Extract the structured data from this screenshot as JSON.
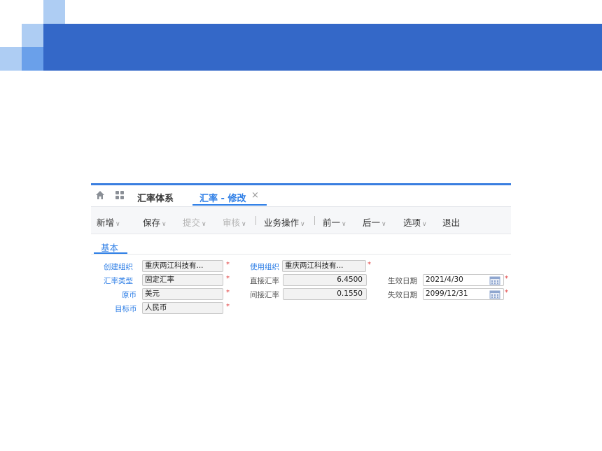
{
  "tabs": {
    "tab1": "汇率体系",
    "tab2": "汇率 - 修改",
    "close": "×"
  },
  "toolbar": {
    "new": "新增",
    "save": "保存",
    "submit": "提交",
    "audit": "审核",
    "business": "业务操作",
    "prev": "前一",
    "next": "后一",
    "options": "选项",
    "exit": "退出",
    "caret": "∨"
  },
  "subtab": "基本",
  "form": {
    "create_org_label": "创建组织",
    "create_org_value": "重庆两江科技有...",
    "rate_type_label": "汇率类型",
    "rate_type_value": "固定汇率",
    "source_currency_label": "原币",
    "source_currency_value": "美元",
    "target_currency_label": "目标币",
    "target_currency_value": "人民币",
    "use_org_label": "使用组织",
    "use_org_value": "重庆两江科技有...",
    "direct_rate_label": "直接汇率",
    "direct_rate_value": "6.4500",
    "indirect_rate_label": "间接汇率",
    "indirect_rate_value": "0.1550",
    "effective_date_label": "生效日期",
    "effective_date_value": "2021/4/30",
    "expiry_date_label": "失效日期",
    "expiry_date_value": "2099/12/31",
    "required_mark": "*"
  },
  "colors": {
    "banner": "#3468c8",
    "accent": "#2d7ee6",
    "required": "#e03c3c"
  }
}
